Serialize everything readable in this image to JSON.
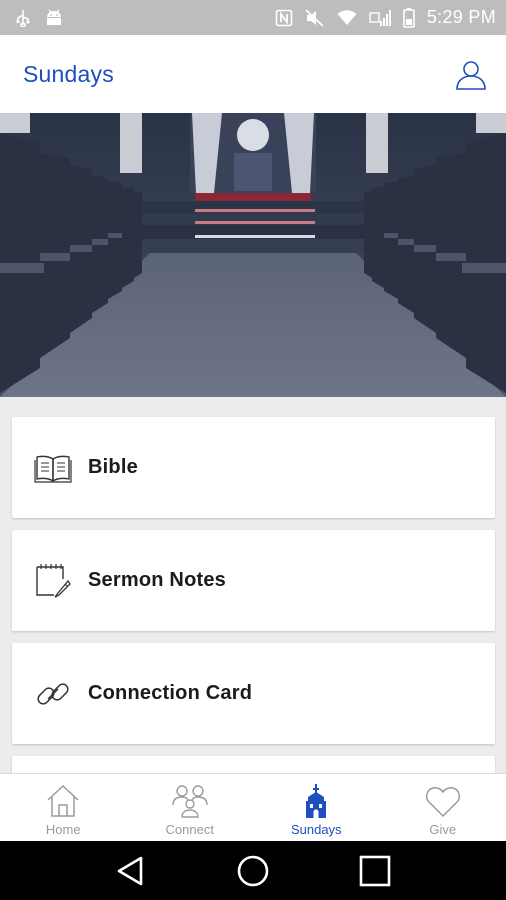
{
  "status_bar": {
    "time": "5:29 PM",
    "icons": [
      "usb-icon",
      "android-debug-icon",
      "nfc-icon",
      "mute-icon",
      "wifi-icon",
      "signal-icon",
      "battery-icon"
    ]
  },
  "header": {
    "title": "Sundays",
    "profile_icon": "user-profile-icon"
  },
  "colors": {
    "accent": "#1e4fbf",
    "status_bar": "#bdbdbd",
    "background": "#ececec",
    "inactive": "#9a9a9a"
  },
  "menu": {
    "items": [
      {
        "label": "Bible",
        "icon": "open-book-icon"
      },
      {
        "label": "Sermon Notes",
        "icon": "notepad-pencil-icon"
      },
      {
        "label": "Connection Card",
        "icon": "link-icon"
      }
    ]
  },
  "bottom_nav": {
    "items": [
      {
        "label": "Home",
        "icon": "home-icon",
        "active": false
      },
      {
        "label": "Connect",
        "icon": "people-icon",
        "active": false
      },
      {
        "label": "Sundays",
        "icon": "church-icon",
        "active": true
      },
      {
        "label": "Give",
        "icon": "heart-icon",
        "active": false
      }
    ]
  },
  "system_nav": {
    "buttons": [
      "back-icon",
      "home-circle-icon",
      "recents-icon"
    ]
  }
}
